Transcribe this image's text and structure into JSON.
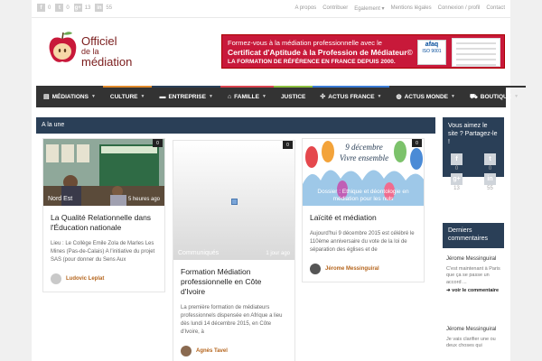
{
  "topbar": {
    "social": [
      {
        "icon": "facebook-icon",
        "glyph": "f",
        "count": "0"
      },
      {
        "icon": "twitter-icon",
        "glyph": "t",
        "count": "0"
      },
      {
        "icon": "googleplus-icon",
        "glyph": "g+",
        "count": "13"
      },
      {
        "icon": "linkedin-icon",
        "glyph": "in",
        "count": "55"
      }
    ],
    "links": [
      "A propos",
      "Contribuer",
      "Egalement ▾",
      "Mentions légales",
      "Connexion / profil",
      "Contact"
    ]
  },
  "logo": {
    "line1": "Officiel",
    "line2": "de la",
    "line3": "médiation"
  },
  "banner": {
    "line1": "Formez-vous à la médiation professionnelle  avec le",
    "line2": "Certificat d'Aptitude à la Profession de Médiateur©",
    "line3": "LA FORMATION DE RÉFÉRENCE EN FRANCE DEPUIS 2000.",
    "afaq": "afaq",
    "iso": "ISO 9001"
  },
  "nav": [
    {
      "icon": "list-icon",
      "glyph": "▤",
      "label": "Médiations",
      "color": "#333333",
      "caret": true
    },
    {
      "icon": "",
      "glyph": "",
      "label": "Culture",
      "color": "#e08a2c",
      "caret": true
    },
    {
      "icon": "briefcase-icon",
      "glyph": "▬",
      "label": "Entreprise",
      "color": "#2a3f57",
      "caret": true
    },
    {
      "icon": "home-icon",
      "glyph": "⌂",
      "label": "Famille",
      "color": "#d9434e",
      "caret": true
    },
    {
      "icon": "",
      "glyph": "",
      "label": "Justice",
      "color": "#8dbf3f",
      "caret": false
    },
    {
      "icon": "arrows-icon",
      "glyph": "✣",
      "label": "Actus France",
      "color": "#3a7bd5",
      "caret": true
    },
    {
      "icon": "globe-icon",
      "glyph": "◍",
      "label": "Actus monde",
      "color": "#333333",
      "caret": true
    },
    {
      "icon": "cart-icon",
      "glyph": "⛟",
      "label": "Boutique",
      "color": "#333333",
      "caret": true
    }
  ],
  "main": {
    "section_title": "A la une",
    "cards": [
      {
        "badge": "0",
        "category": "Nord Est",
        "time": "5 heures ago",
        "title": "La Qualité Relationnelle dans l'Éducation nationale",
        "excerpt": "Lieu : Le Collège Emile Zola de Marles Les Mines (Pas-de-Calais) A l'initiative du projet SAS (pour donner du Sens Aux",
        "author": "Ludovic Leplat"
      },
      {
        "badge": "0",
        "category": "Communiqués",
        "time": "1 jour ago",
        "title": "Formation Médiation professionnelle en Côte d'Ivoire",
        "excerpt": "La première formation de médiateurs professionnels dispensée en Afrique a lieu dès lundi 14 décembre 2015, en Côte d'Ivoire, à",
        "author": "Agnès Tavel"
      },
      {
        "badge": "0",
        "category": "Dossier : Ethique et déontologie en médiation pour les nuls",
        "time": "",
        "title": "Laïcité et médiation",
        "excerpt": "Aujourd'hui 9 décembre 2015 est célébré le 110ème anniversaire du vote de la loi de séparation des églises et de",
        "author": "Jérome Messinguiral",
        "img_line1": "9 décembre",
        "img_line2": "Vivre ensemble"
      }
    ]
  },
  "sidebar": {
    "share_title": "Vous aimez le site ? Partagez-le !",
    "share": [
      {
        "icon": "facebook-icon",
        "glyph": "f",
        "count": "0"
      },
      {
        "icon": "twitter-icon",
        "glyph": "t",
        "count": "0"
      },
      {
        "icon": "googleplus-icon",
        "glyph": "g+",
        "count": "13"
      },
      {
        "icon": "linkedin-icon",
        "glyph": "in",
        "count": "55"
      }
    ],
    "comments_title": "Derniers commentaires",
    "comments": [
      {
        "who": "Jérome Messinguiral",
        "excerpt": "C'est maintenant à Paris que ça se passe un accord ...",
        "link": "voir le commentaire"
      },
      {
        "who": "Jérome Messinguiral",
        "excerpt": "Je vais clarifier une ou deux choses qui",
        "link": ""
      }
    ]
  }
}
